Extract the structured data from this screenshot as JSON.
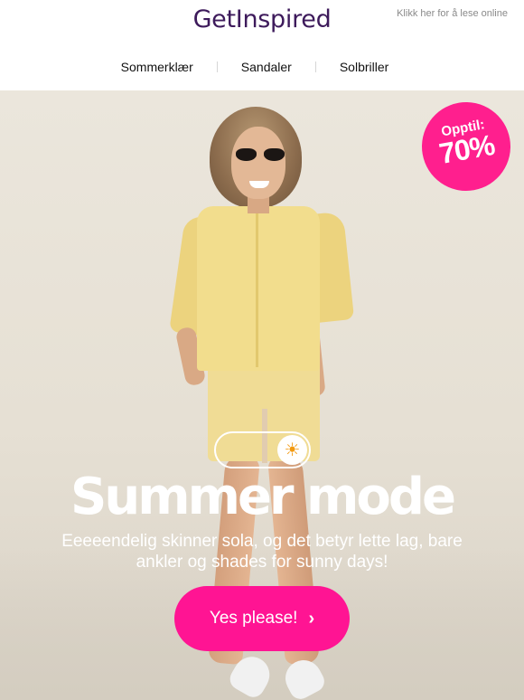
{
  "header": {
    "logo": "GetInspired",
    "read_online": "Klikk her for å lese online"
  },
  "nav": {
    "items": [
      {
        "label": "Sommerklær"
      },
      {
        "label": "Sandaler"
      },
      {
        "label": "Solbriller"
      }
    ]
  },
  "hero": {
    "badge": {
      "line1": "Opptil:",
      "line2": "70%"
    },
    "toggle_icon": "sun-icon",
    "headline": "Summer mode",
    "subtext": "Eeeeendelig skinner sola, og det betyr lette lag, bare ankler og shades for sunny days!",
    "cta_label": "Yes please!",
    "cta_chevron": "›"
  },
  "colors": {
    "brand": "#3d1a5b",
    "accent": "#ff1493",
    "badge": "#ff1f8e"
  }
}
